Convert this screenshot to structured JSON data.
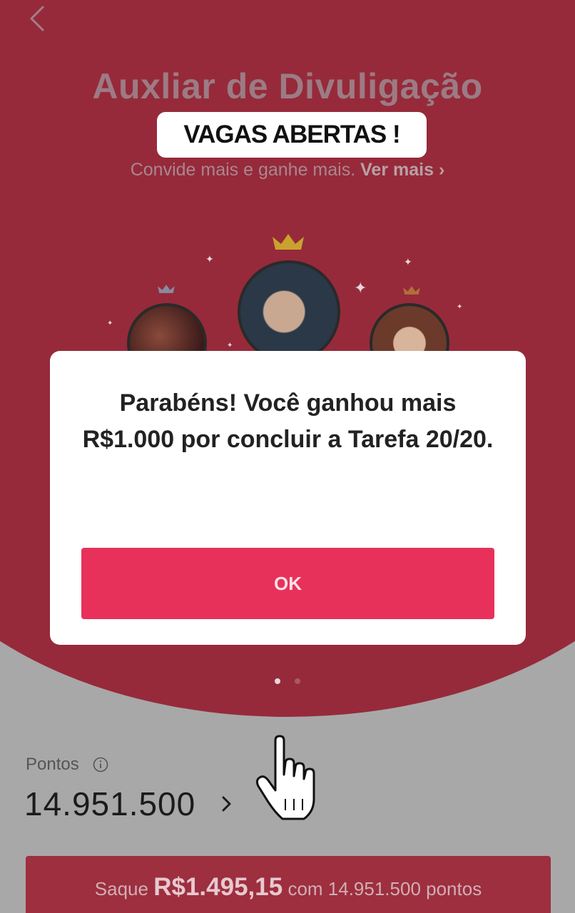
{
  "header": {
    "title": "Auxliar de Divuligação",
    "badge": "VAGAS ABERTAS !",
    "subtitle": "Convide mais e ganhe mais.",
    "see_more": "Ver mais",
    "see_more_chevron": "›"
  },
  "icons": {
    "back": "chevron-left-icon",
    "info": "info-icon",
    "chevron": "chevron-right-icon",
    "cursor": "hand-cursor-icon",
    "crown": "crown-icon"
  },
  "modal": {
    "message": "Parabéns! Você ganhou mais R$1.000 por concluir a Tarefa 20/20.",
    "ok_label": "OK"
  },
  "carousel": {
    "active_index": 0,
    "count": 2
  },
  "points": {
    "label": "Pontos",
    "value": "14.951.500",
    "chevron": "›"
  },
  "withdraw": {
    "prefix": "Saque",
    "amount": "R$1.495,15",
    "suffix": "com 14.951.500 pontos"
  },
  "colors": {
    "header_red": "#962a3a",
    "ok_button": "#e8315a",
    "modal_bg": "#ffffff",
    "page_bg": "#a8a8a8"
  }
}
